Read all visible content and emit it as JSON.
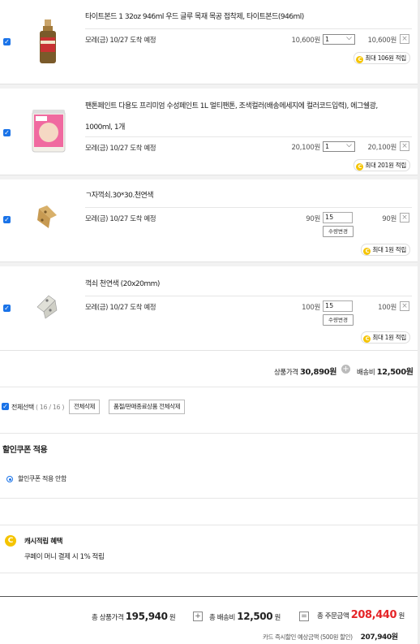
{
  "items": [
    {
      "title": "타이트본드 1 32oz 946ml 우드 글루 목재 목공 접착제, 타이트본드(946ml)",
      "shipping": "모레(금) 10/27 도착 예정",
      "unit_price": "10,600원",
      "qty": "1",
      "total_price": "10,600원",
      "point": "최대 106원 적립"
    },
    {
      "title_line1": "팬톤페인트 다용도 프리미엄 수성페인트 1L 멀티팬톤, 조색컬러(배송메세지에 컬러코드입력), 에그쉘광,",
      "title_line2": "1000ml, 1개",
      "shipping": "모레(금) 10/27 도착 예정",
      "unit_price": "20,100원",
      "qty": "1",
      "total_price": "20,100원",
      "point": "최대 201원 적립"
    },
    {
      "title": "ㄱ자꺽쇠.30*30.천연색",
      "shipping": "모레(금) 10/27 도착 예정",
      "unit_price": "90원",
      "qty": "15",
      "qty_button": "수량변경",
      "total_price": "90원",
      "point": "최대 1원 적립"
    },
    {
      "title": "꺽쇠 천연색 (20x20mm)",
      "shipping": "모레(금) 10/27 도착 예정",
      "unit_price": "100원",
      "qty": "15",
      "qty_button": "수량변경",
      "total_price": "100원",
      "point": "최대 1원 적립"
    }
  ],
  "subtotal": {
    "product_label": "상품가격",
    "product_value": "30,890원",
    "shipping_label": "배송비",
    "shipping_value": "12,500원"
  },
  "actions": {
    "select_all": "전체선택",
    "select_count": "( 16 / 16 )",
    "delete_all": "전체삭제",
    "delete_soldout": "품절/판매종료상품 전체삭제"
  },
  "coupon": {
    "title": "할인쿠폰 적용",
    "option": "할인쿠폰 적용 안함"
  },
  "cash": {
    "title": "캐시적립 혜택",
    "desc": "쿠페이 머니 결제 시 1% 적립"
  },
  "total": {
    "product_label": "총 상품가격",
    "product_value": "195,940",
    "won": "원",
    "shipping_label": "총 배송비",
    "shipping_value": "12,500",
    "order_label": "총 주문금액",
    "order_value": "208,440",
    "card_label": "카드 즉시할인 예상금액 (500원 할인)",
    "card_value": "207,940원"
  },
  "colors": {
    "accent_red": "#e52528",
    "coin_yellow": "#f5c400",
    "checkbox_blue": "#1a73e8"
  },
  "icons": {
    "plus": "+",
    "equals": "=",
    "coin": "C",
    "check": "✓",
    "close": "×",
    "caret": "⌵"
  }
}
